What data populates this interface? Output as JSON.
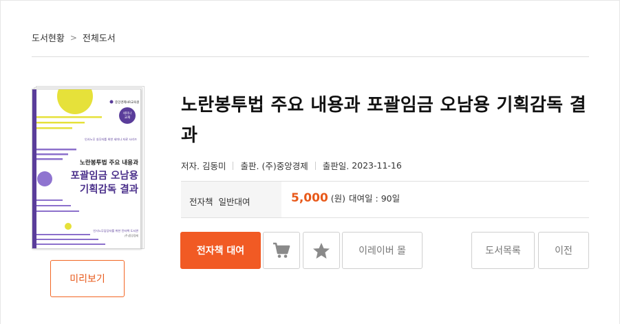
{
  "breadcrumb": {
    "home": "도서현황",
    "separator": ">",
    "current": "전체도서"
  },
  "book": {
    "title": "노란봉투법 주요 내용과 포괄임금 오남용 기획감독 결과",
    "author_label": "저자.",
    "author": "김동미",
    "publisher_label": "출판.",
    "publisher": "(주)중앙경제",
    "pubdate_label": "출판일.",
    "pubdate": "2023-11-16"
  },
  "cover": {
    "publisher_logo": "중앙경제HR교육원",
    "badge_line1": "세미나",
    "badge_line2": "교재",
    "series_note": "인사노무 실무자를 위한 세미나 자료 시리즈",
    "title_line1": "노란봉투법 주요 내용과",
    "title_line2": "포괄임금 오남용",
    "title_line3": "기획감독 결과",
    "footer_line1": "인사노무담당자를 위한 전자책 도서관",
    "footer_line2": "(주)중앙경제",
    "accent_color": "#5a3d9a",
    "sun_color": "#e6e13a"
  },
  "preview_button": "미리보기",
  "pricing": {
    "label": "전자책  일반대여",
    "price": "5,000",
    "unit": "(원)",
    "rental_period": "대여일 : 90일",
    "price_color": "#e8591a"
  },
  "actions": {
    "rent": "전자책 대여",
    "cart_icon": "cart-icon",
    "star_icon": "star-icon",
    "ereader": "이레이버 몰",
    "list": "도서목록",
    "prev": "이전"
  }
}
